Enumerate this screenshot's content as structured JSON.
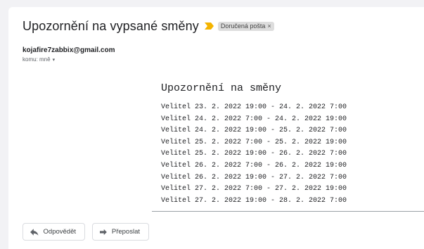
{
  "email": {
    "subject": "Upozornění na vypsané směny",
    "label": "Doručená pošta",
    "label_remove_symbol": "×",
    "importance_icon": "importance-marker-icon",
    "sender": "kojafire7zabbix@gmail.com",
    "recipient": "komu: mně",
    "recipient_caret": "▾"
  },
  "body": {
    "title": "Upozornění na směny",
    "shifts": [
      "Velitel 23. 2. 2022 19:00 - 24. 2. 2022 7:00",
      "Velitel 24. 2. 2022 7:00 - 24. 2. 2022 19:00",
      "Velitel 24. 2. 2022 19:00 - 25. 2. 2022 7:00",
      "Velitel 25. 2. 2022 7:00 - 25. 2. 2022 19:00",
      "Velitel 25. 2. 2022 19:00 - 26. 2. 2022 7:00",
      "Velitel 26. 2. 2022 7:00 - 26. 2. 2022 19:00",
      "Velitel 26. 2. 2022 19:00 - 27. 2. 2022 7:00",
      "Velitel 27. 2. 2022 7:00 - 27. 2. 2022 19:00",
      "Velitel 27. 2. 2022 19:00 - 28. 2. 2022 7:00"
    ]
  },
  "actions": {
    "reply_label": "Odpovědět",
    "forward_label": "Přeposlat"
  },
  "colors": {
    "importance": "#f4b400",
    "label_chip_bg": "#dddddd",
    "page_bg": "#f2f2f5"
  }
}
